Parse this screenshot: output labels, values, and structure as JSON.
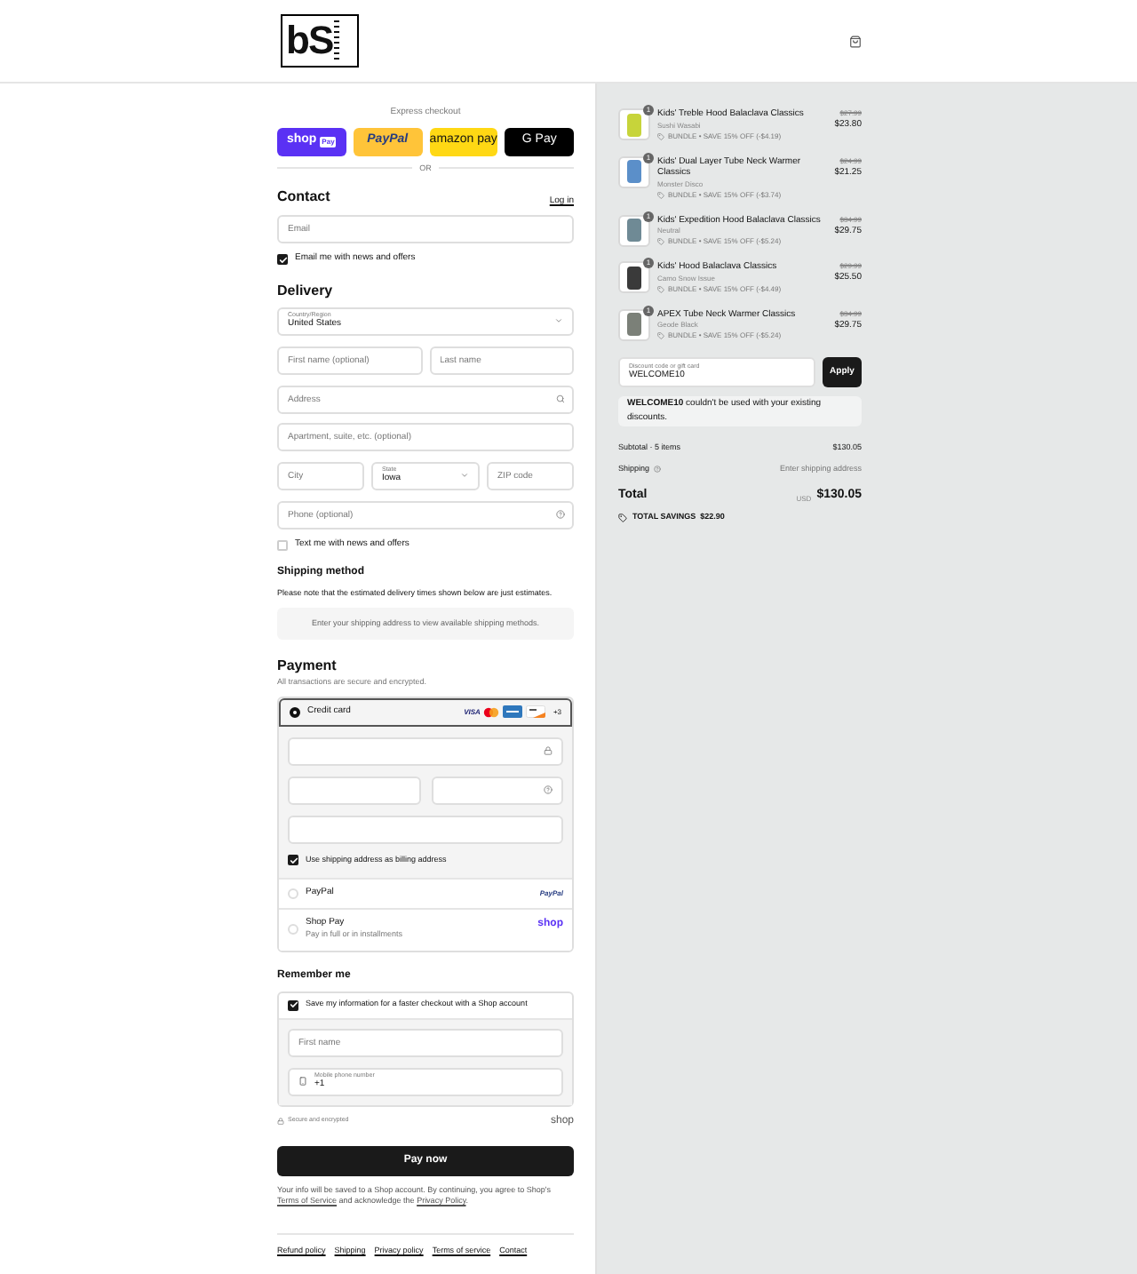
{
  "header": {
    "logo": "bS"
  },
  "express": {
    "title": "Express checkout",
    "buttons": [
      {
        "kind": "shop",
        "label": "shop",
        "tag": "Pay"
      },
      {
        "kind": "paypal",
        "label": "PayPal"
      },
      {
        "kind": "amazon",
        "label": "amazon pay"
      },
      {
        "kind": "gpay",
        "label": "G Pay"
      }
    ],
    "divider": "OR"
  },
  "contact": {
    "title": "Contact",
    "login": "Log in",
    "email": {
      "placeholder": "Email"
    },
    "news": {
      "label": "Email me with news and offers",
      "checked": true
    }
  },
  "delivery": {
    "title": "Delivery",
    "country": {
      "label": "Country/Region",
      "value": "United States"
    },
    "first_name": {
      "placeholder": "First name (optional)"
    },
    "last_name": {
      "placeholder": "Last name"
    },
    "address": {
      "placeholder": "Address"
    },
    "apartment": {
      "placeholder": "Apartment, suite, etc. (optional)"
    },
    "city": {
      "placeholder": "City"
    },
    "state": {
      "label": "State",
      "value": "Iowa"
    },
    "zip": {
      "placeholder": "ZIP code"
    },
    "phone": {
      "placeholder": "Phone (optional)"
    },
    "text_me": {
      "label": "Text me with news and offers",
      "checked": false
    }
  },
  "shipping_method": {
    "title": "Shipping method",
    "note": "Please note that the estimated delivery times shown below are just estimates.",
    "message": "Enter your shipping address to view available shipping methods."
  },
  "payment": {
    "title": "Payment",
    "subtitle": "All transactions are secure and encrypted.",
    "methods": [
      {
        "kind": "card",
        "label": "Credit card",
        "selected": true,
        "brands": [
          {
            "kind": "visa",
            "label": "VISA"
          },
          {
            "kind": "mastercard"
          },
          {
            "kind": "amex"
          },
          {
            "kind": "discover"
          }
        ],
        "more": "+3",
        "billing": {
          "label": "Use shipping address as billing address",
          "checked": true
        }
      },
      {
        "kind": "paypal",
        "label": "PayPal",
        "selected": false,
        "logo": "PayPal"
      },
      {
        "kind": "shoppay",
        "label": "Shop Pay",
        "sublabel": "Pay in full or in installments",
        "selected": false,
        "logo": "shop"
      }
    ]
  },
  "remember": {
    "title": "Remember me",
    "save": {
      "label": "Save my information for a faster checkout with a Shop account",
      "checked": true
    },
    "first_name": {
      "placeholder": "First name"
    },
    "mobile": {
      "label": "Mobile phone number",
      "value": "+1"
    },
    "secure": "Secure and encrypted",
    "shop_logo": "shop"
  },
  "pay_button": "Pay now",
  "consent": {
    "before": "Your info will be saved to a Shop account. By continuing, you agree to Shop's ",
    "terms": "Terms of Service",
    "middle": " and acknowledge the ",
    "privacy": "Privacy Policy",
    "after": "."
  },
  "footer_links": [
    "Refund policy",
    "Shipping",
    "Privacy policy",
    "Terms of service",
    "Contact"
  ],
  "cart": {
    "items": [
      {
        "name": "Kids' Treble Hood Balaclava Classics",
        "variant": "Sushi Wasabi",
        "discount": "BUNDLE • SAVE 15% OFF (-$4.19)",
        "old_price": "$27.99",
        "price": "$23.80",
        "quantity": "1",
        "color": "#c7d43a"
      },
      {
        "name": "Kids' Dual Layer Tube Neck Warmer Classics",
        "variant": "Monster Disco",
        "discount": "BUNDLE • SAVE 15% OFF (-$3.74)",
        "old_price": "$24.99",
        "price": "$21.25",
        "quantity": "1",
        "color": "#5b8fc9"
      },
      {
        "name": "Kids' Expedition Hood Balaclava Classics",
        "variant": "Neutral",
        "discount": "BUNDLE • SAVE 15% OFF (-$5.24)",
        "old_price": "$34.99",
        "price": "$29.75",
        "quantity": "1",
        "color": "#6f8a95"
      },
      {
        "name": "Kids' Hood Balaclava Classics",
        "variant": "Camo Snow Issue",
        "discount": "BUNDLE • SAVE 15% OFF (-$4.49)",
        "old_price": "$29.99",
        "price": "$25.50",
        "quantity": "1",
        "color": "#3a3a3a"
      },
      {
        "name": "APEX Tube Neck Warmer Classics",
        "variant": "Geode Black",
        "discount": "BUNDLE • SAVE 15% OFF (-$5.24)",
        "old_price": "$34.99",
        "price": "$29.75",
        "quantity": "1",
        "color": "#7b8078"
      }
    ],
    "discount_field": {
      "label": "Discount code or gift card",
      "value": "WELCOME10"
    },
    "apply": "Apply",
    "message": "**WELCOME10** couldn't be used with your existing discounts.",
    "subtotal_label": "Subtotal · 5 items",
    "subtotal": "$130.05",
    "shipping_label": "Shipping",
    "shipping": "Enter shipping address",
    "total_label": "Total",
    "currency": "USD",
    "total": "$130.05",
    "savings": "TOTAL SAVINGS  $22.90"
  }
}
